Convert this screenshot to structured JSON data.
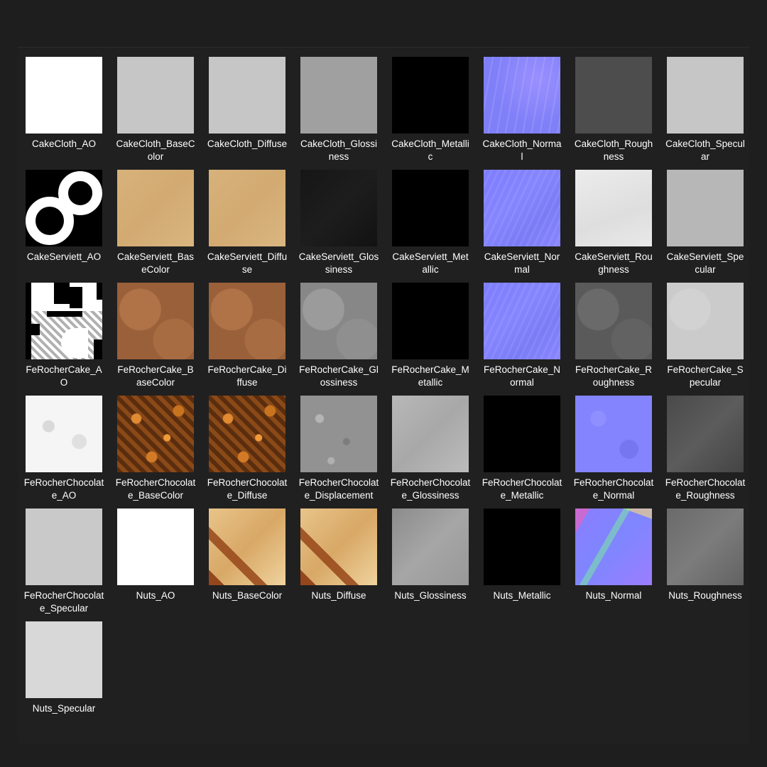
{
  "folder": {
    "items": [
      {
        "name": "CakeCloth_AO",
        "texture": "white"
      },
      {
        "name": "CakeCloth_BaseColor",
        "texture": "light-grey"
      },
      {
        "name": "CakeCloth_Diffuse",
        "texture": "light-grey"
      },
      {
        "name": "CakeCloth_Glossiness",
        "texture": "mid-grey"
      },
      {
        "name": "CakeCloth_Metallic",
        "texture": "black"
      },
      {
        "name": "CakeCloth_Normal",
        "texture": "normal-map"
      },
      {
        "name": "CakeCloth_Roughness",
        "texture": "dark-grey"
      },
      {
        "name": "CakeCloth_Specular",
        "texture": "light-grey"
      },
      {
        "name": "CakeServiett_AO",
        "texture": "rings"
      },
      {
        "name": "CakeServiett_BaseColor",
        "texture": "sand"
      },
      {
        "name": "CakeServiett_Diffuse",
        "texture": "sand"
      },
      {
        "name": "CakeServiett_Glossiness",
        "texture": "very-dark"
      },
      {
        "name": "CakeServiett_Metallic",
        "texture": "black"
      },
      {
        "name": "CakeServiett_Normal",
        "texture": "normal-map"
      },
      {
        "name": "CakeServiett_Roughness",
        "texture": "off-white"
      },
      {
        "name": "CakeServiett_Specular",
        "texture": "grey"
      },
      {
        "name": "FeRocherCake_AO",
        "texture": "ao-blocks"
      },
      {
        "name": "FeRocherCake_BaseColor",
        "texture": "brown"
      },
      {
        "name": "FeRocherCake_Diffuse",
        "texture": "brown"
      },
      {
        "name": "FeRocherCake_Glossiness",
        "texture": "grey-patch"
      },
      {
        "name": "FeRocherCake_Metallic",
        "texture": "black"
      },
      {
        "name": "FeRocherCake_Normal",
        "texture": "normal-map"
      },
      {
        "name": "FeRocherCake_Roughness",
        "texture": "rough-patch"
      },
      {
        "name": "FeRocherCake_Specular",
        "texture": "light-grey"
      },
      {
        "name": "FeRocherChocolate_AO",
        "texture": "white-speckle"
      },
      {
        "name": "FeRocherChocolate_BaseColor",
        "texture": "chocolate"
      },
      {
        "name": "FeRocherChocolate_Diffuse",
        "texture": "chocolate"
      },
      {
        "name": "FeRocherChocolate_Displacement",
        "texture": "displacement"
      },
      {
        "name": "FeRocherChocolate_Glossiness",
        "texture": "light-grey-patch"
      },
      {
        "name": "FeRocherChocolate_Metallic",
        "texture": "black"
      },
      {
        "name": "FeRocherChocolate_Normal",
        "texture": "normal-map"
      },
      {
        "name": "FeRocherChocolate_Roughness",
        "texture": "dark-grey"
      },
      {
        "name": "FeRocherChocolate_Specular",
        "texture": "light-grey"
      },
      {
        "name": "Nuts_AO",
        "texture": "white"
      },
      {
        "name": "Nuts_BaseColor",
        "texture": "nuts"
      },
      {
        "name": "Nuts_Diffuse",
        "texture": "nuts"
      },
      {
        "name": "Nuts_Glossiness",
        "texture": "grey"
      },
      {
        "name": "Nuts_Metallic",
        "texture": "black"
      },
      {
        "name": "Nuts_Normal",
        "texture": "normal-map"
      },
      {
        "name": "Nuts_Roughness",
        "texture": "grey"
      },
      {
        "name": "Nuts_Specular",
        "texture": "light-grey"
      }
    ]
  }
}
